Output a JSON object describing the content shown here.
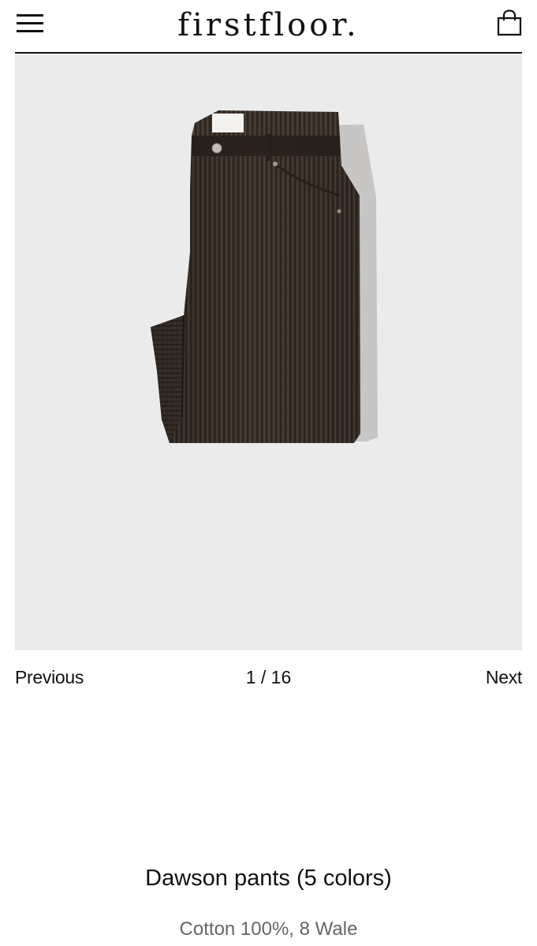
{
  "header": {
    "brand": "firstfloor.",
    "menu_icon": "hamburger-menu-icon",
    "bag_icon": "shopping-bag-icon"
  },
  "gallery": {
    "image": "brown-corduroy-pants-folded",
    "previous_label": "Previous",
    "counter": "1 / 16",
    "next_label": "Next",
    "background_color": "#ebebeb"
  },
  "product": {
    "title": "Dawson pants (5 colors)",
    "subtitle": "Cotton 100%, 8 Wale"
  }
}
